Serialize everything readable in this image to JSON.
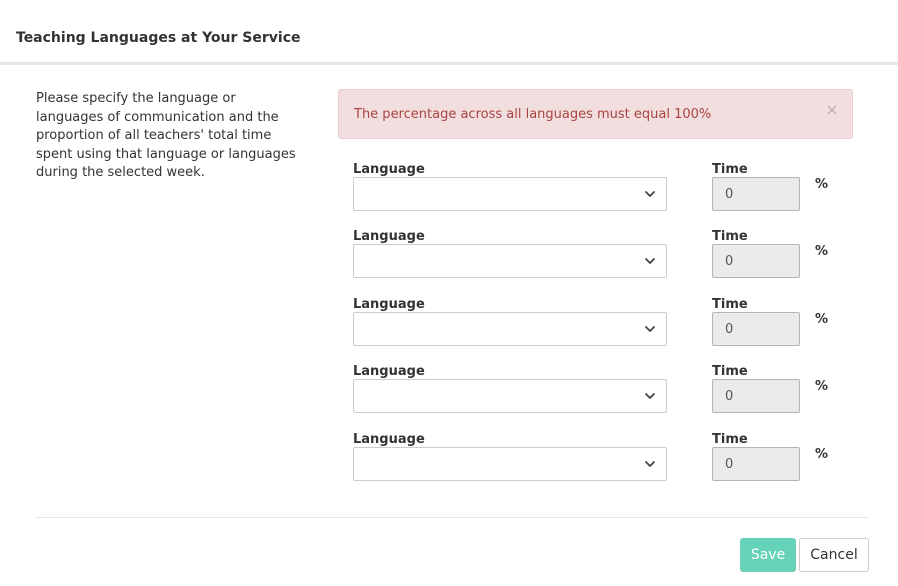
{
  "modal": {
    "title": "Teaching Languages at Your Service",
    "description": "Please specify the language or languages of communication and the proportion of all teachers' total time spent using that language or languages during the selected week."
  },
  "alert": {
    "message": "The percentage across all languages must equal 100%",
    "close_symbol": "×",
    "background_color": "#f2dede",
    "text_color": "#a94442"
  },
  "rows": [
    {
      "language_label": "Language",
      "language_value": "",
      "time_label": "Time",
      "time_value": "0",
      "unit": "%"
    },
    {
      "language_label": "Language",
      "language_value": "",
      "time_label": "Time",
      "time_value": "0",
      "unit": "%"
    },
    {
      "language_label": "Language",
      "language_value": "",
      "time_label": "Time",
      "time_value": "0",
      "unit": "%"
    },
    {
      "language_label": "Language",
      "language_value": "",
      "time_label": "Time",
      "time_value": "0",
      "unit": "%"
    },
    {
      "language_label": "Language",
      "language_value": "",
      "time_label": "Time",
      "time_value": "0",
      "unit": "%"
    }
  ],
  "icons": {
    "select_chevron": "chevron-down-icon",
    "alert_close": "close-icon"
  },
  "footer": {
    "save_label": "Save",
    "cancel_label": "Cancel",
    "save_color": "#66d2b8"
  }
}
